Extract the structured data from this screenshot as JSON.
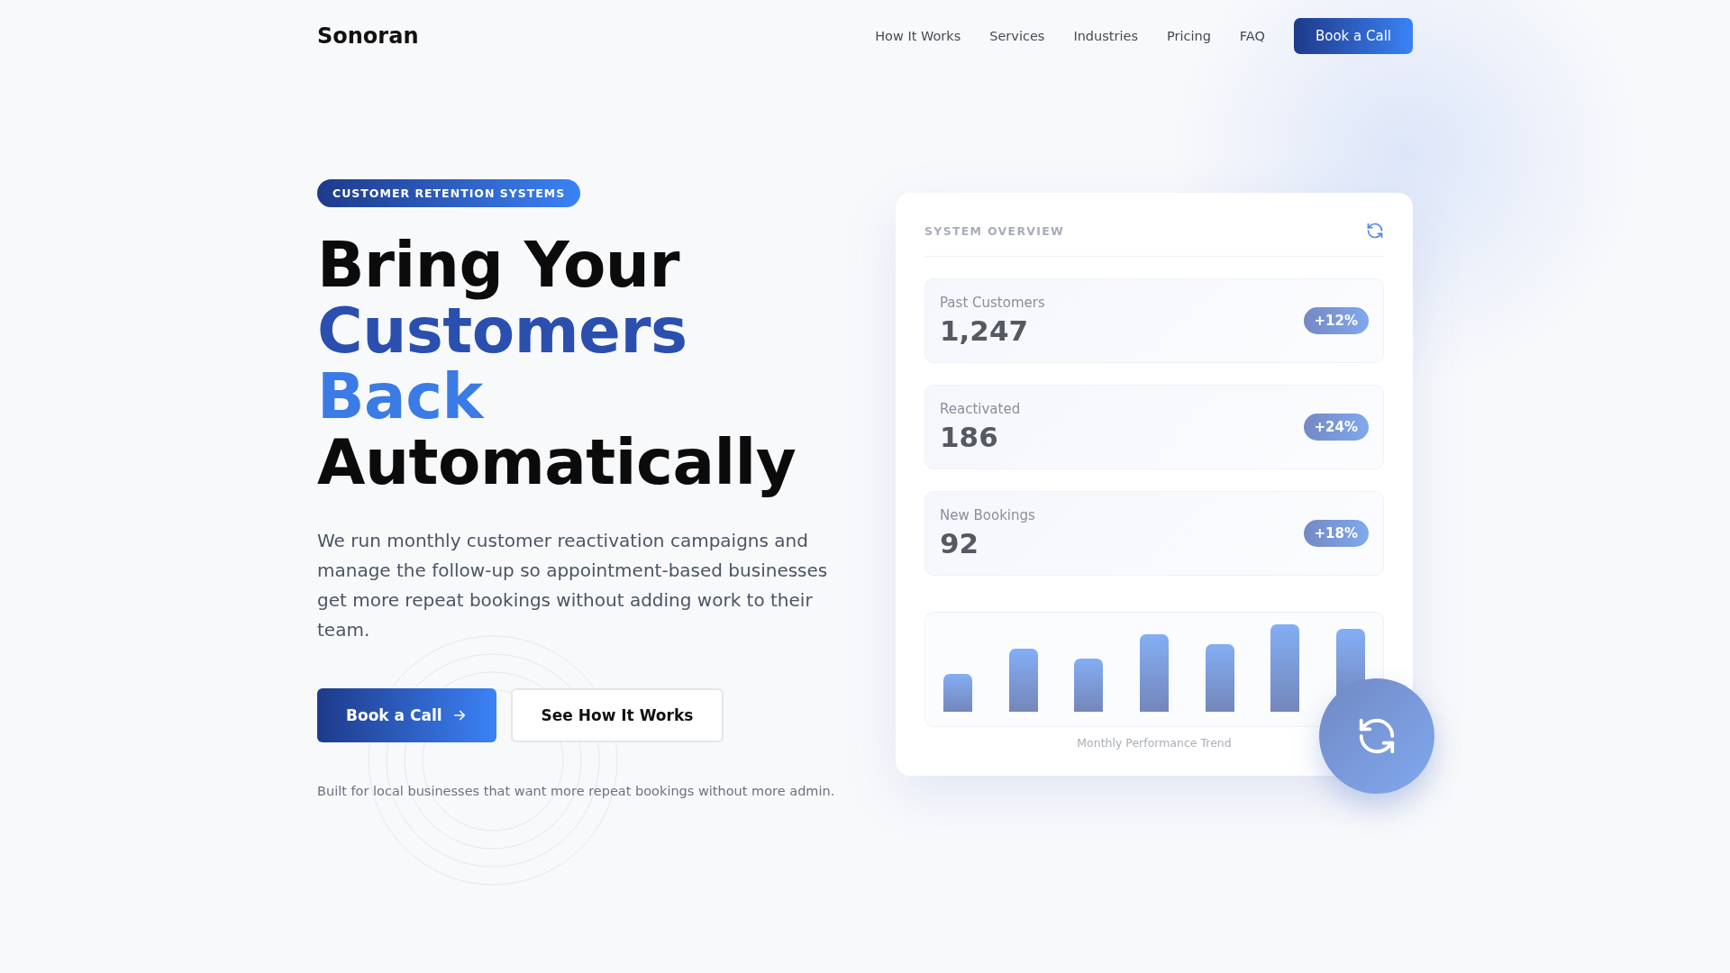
{
  "header": {
    "logo": "Sonoran",
    "nav": [
      "How It Works",
      "Services",
      "Industries",
      "Pricing",
      "FAQ"
    ],
    "cta": "Book a Call"
  },
  "hero": {
    "badge": "CUSTOMER RETENTION SYSTEMS",
    "headline": [
      {
        "text": "Bring Your",
        "color": "#0b0b0c"
      },
      {
        "text": "Customers",
        "color": "#2a4fae"
      },
      {
        "text": "Back",
        "color": "#3b7be6"
      },
      {
        "text": "Automatically",
        "color": "#0b0b0c"
      }
    ],
    "description": "We run monthly customer reactivation campaigns and manage the follow-up so appointment-based businesses get more repeat bookings without adding work to their team.",
    "primary_button": "Book a Call",
    "secondary_button": "See How It Works",
    "footnote": "Built for local businesses that want more repeat bookings without more admin."
  },
  "overview": {
    "title": "SYSTEM OVERVIEW",
    "stats": [
      {
        "label": "Past Customers",
        "value": "1,247",
        "change": "+12%"
      },
      {
        "label": "Reactivated",
        "value": "186",
        "change": "+24%"
      },
      {
        "label": "New Bookings",
        "value": "92",
        "change": "+18%"
      }
    ],
    "chart_caption": "Monthly Performance Trend"
  }
}
